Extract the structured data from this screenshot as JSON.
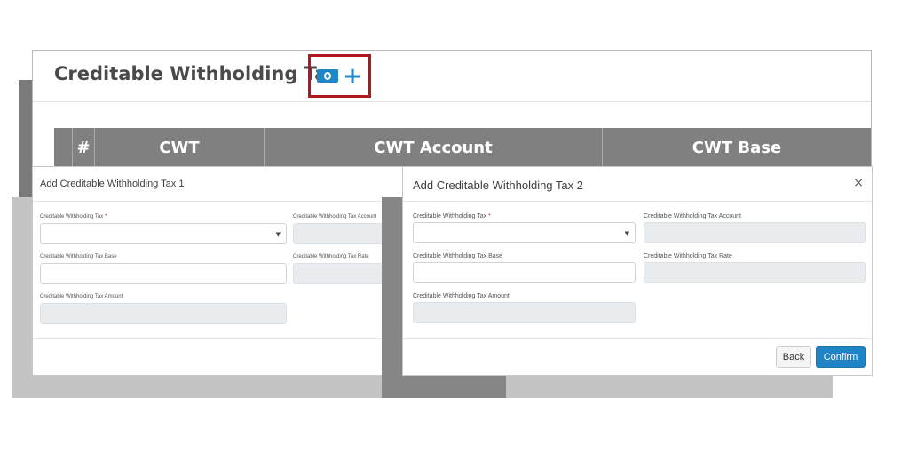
{
  "panel": {
    "title": "Creditable Withholding Tax",
    "icons": [
      "money-icon",
      "plus-icon"
    ],
    "table_headers": [
      "",
      "#",
      "CWT",
      "CWT Account",
      "CWT Base"
    ]
  },
  "dialog1": {
    "title": "Add Creditable Withholding Tax 1",
    "fields": {
      "tax_label": "Creditable Withholding Tax",
      "account_label": "Creditable Withholding Tax Account",
      "base_label": "Creditable Withholding Tax Base",
      "rate_label": "Creditable Withholding Tax Rate",
      "amount_label": "Creditable Withholding Tax Amount"
    },
    "required_mark": "*"
  },
  "dialog2": {
    "title": "Add Creditable Withholding Tax 2",
    "close": "×",
    "fields": {
      "tax_label": "Creditable Withholding Tax",
      "account_label": "Creditable Withholding Tax Account",
      "base_label": "Creditable Withholding Tax Base",
      "rate_label": "Creditable Withholding Tax Rate",
      "amount_label": "Creditable Withholding Tax Amount"
    },
    "required_mark": "*",
    "back_label": "Back",
    "confirm_label": "Confirm"
  },
  "colors": {
    "accent": "#1e84c6",
    "highlight": "#b3171d",
    "table_header": "#808080"
  }
}
